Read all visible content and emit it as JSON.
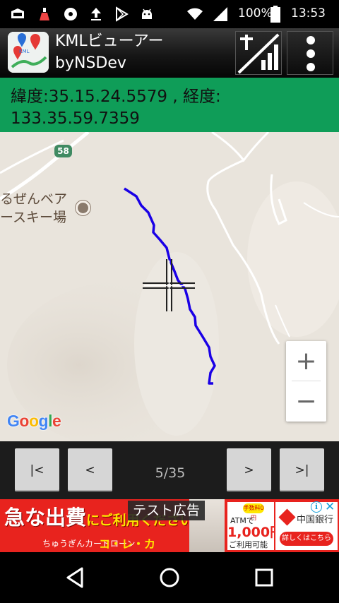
{
  "status_bar": {
    "battery_percent": "100%",
    "time": "13:53"
  },
  "app_bar": {
    "title_line1": "KMLビューアー",
    "title_line2": "byNSDev"
  },
  "coordinates": {
    "line1": "緯度:35.15.24.5579 , 経度:",
    "line2": "133.35.59.7359"
  },
  "map": {
    "road_number": "58",
    "poi_label_line1": "るぜんベア",
    "poi_label_line2": "ースキー場",
    "attribution": "Google",
    "zoom_in": "+",
    "zoom_out": "−",
    "track_color": "#1a00e6"
  },
  "nav_controls": {
    "first_label": "|<",
    "prev_label": "<",
    "page_indicator": "5/35",
    "next_label": ">",
    "last_label": ">|"
  },
  "ad": {
    "test_label": "テスト広告",
    "headline_main": "急な出費",
    "headline_small": "にご利用ください",
    "sub_text": "ちゅうぎんカードローン",
    "brand": "コ・レ・カ",
    "offer_badge": "手数料0円",
    "offer_line1": "ATMで",
    "offer_amount": "1,000円",
    "offer_line3": "ご利用可能",
    "bank_name": "中国銀行",
    "bank_cta": "詳しくはこちら",
    "info_icon": "i",
    "close_icon": "✕"
  },
  "colors": {
    "banner_green": "#0f9d58",
    "map_bg": "#e9e4dc",
    "ad_red": "#e8231e"
  }
}
